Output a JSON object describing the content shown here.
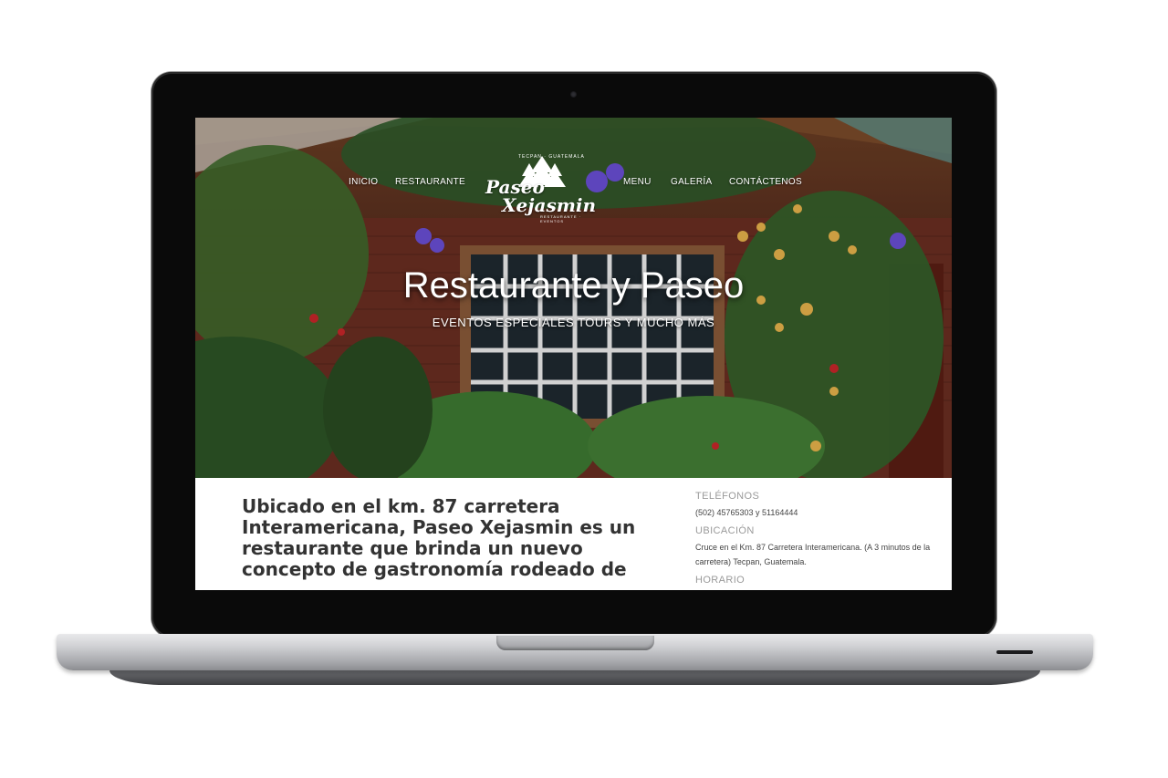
{
  "nav": {
    "items": [
      {
        "label": "INICIO"
      },
      {
        "label": "RESTAURANTE"
      },
      {
        "label": "MENU"
      },
      {
        "label": "GALERÍA"
      },
      {
        "label": "CONTÁCTENOS"
      }
    ]
  },
  "logo": {
    "word1": "Paseo",
    "word2": "Xejasmin",
    "top_text": "TECPAN · GUATEMALA",
    "bottom_text": "RESTAURANTE · EVENTOS"
  },
  "hero": {
    "title": "Restaurante y Paseo",
    "subtitle": "EVENTOS ESPECIALES TOURS Y MUCHO MÁS"
  },
  "content": {
    "intro": "Ubicado en el km. 87 carretera Interamericana, Paseo Xejasmin es un restaurante que brinda un nuevo concepto de gastronomía rodeado de",
    "phones_label": "TELÉFONOS",
    "phones_value": "(502) 45765303 y 51164444",
    "location_label": "UBICACIÓN",
    "location_value": "Cruce en el Km. 87 Carretera Interamericana. (A 3 minutos de la carretera) Tecpan, Guatemala.",
    "hours_label": "HORARIO"
  }
}
